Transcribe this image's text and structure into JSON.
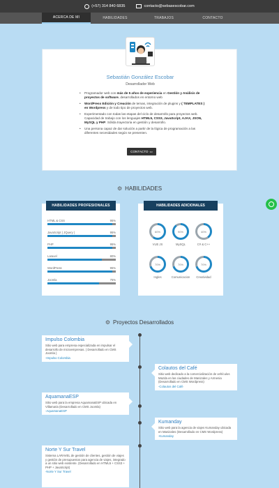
{
  "topbar": {
    "phone": "(+57) 314 840 6835",
    "email": "contacto@sebasescobar.com"
  },
  "nav": {
    "items": [
      {
        "label": "ACERCA DE MI"
      },
      {
        "label": "HABILIDADES"
      },
      {
        "label": "TRABAJOS"
      },
      {
        "label": "CONTACTO"
      }
    ]
  },
  "profile": {
    "name": "Sebastián González Escobar",
    "role": "Desarrollador Web",
    "bullets": [
      {
        "pre": "Programador web con ",
        "b1": "más de 5 años de experiencia",
        "mid": " en ",
        "b2": "Gestión y Análisis de proyectos de software",
        "post": ", desarrollados en entorno web"
      },
      {
        "pre": "",
        "b1": "WordPress Edición y Creación",
        "mid": " de temas, integración de plugins y ",
        "b2": "( TEMPLATES ) en Wordpress",
        "post": " y de todo tipo de proyectos web."
      },
      {
        "pre": "Experimentado con todas las etapas del ciclo de desarrollo para proyectos web. Capacidad de trabajo con los lenguajes ",
        "b1": "HTML5, CSS3, JavaScript, AJAX, JSON, MySQL y PHP",
        "mid": ". Sólida trayectoria en gestión y desarrollo.",
        "b2": "",
        "post": ""
      },
      {
        "pre": "Una persona capaz de dar solución a partir de la lógica de programación a las diferentes necesidades según se presenten.",
        "b1": "",
        "mid": "",
        "b2": "",
        "post": ""
      }
    ],
    "contact_label": "CONTACTO"
  },
  "skills_section": {
    "title": "HABILIDADES"
  },
  "professional": {
    "title": "HABILIDADES PROFESIONALES",
    "items": [
      {
        "name": "HTML & CSS",
        "pct": "95%",
        "value": 95
      },
      {
        "name": "JavaScript ( JQuery )",
        "pct": "95%",
        "value": 95
      },
      {
        "name": "PHP",
        "pct": "95%",
        "value": 95
      },
      {
        "name": "Laravel",
        "pct": "80%",
        "value": 80
      },
      {
        "name": "WordPress",
        "pct": "95%",
        "value": 95
      },
      {
        "name": "Joomla",
        "pct": "75%",
        "value": 75
      }
    ]
  },
  "additional": {
    "title": "HABILIDADES ADICIONALES",
    "items": [
      {
        "name": "VUE JS",
        "pct": "60%",
        "value": 60
      },
      {
        "name": "MySQL",
        "pct": "90%",
        "value": 90
      },
      {
        "name": "C# & C++",
        "pct": "40%",
        "value": 40
      },
      {
        "name": "Ingles",
        "pct": "70%",
        "value": 70
      },
      {
        "name": "Comunicacion",
        "pct": "70%",
        "value": 70
      },
      {
        "name": "Creatividad",
        "pct": "70%",
        "value": 70
      }
    ]
  },
  "projects_section": {
    "title": "Proyectos Desarrollados"
  },
  "projects": [
    {
      "title": "Impulso Colombia",
      "desc": "Sitio web para empresa especializada en impulsar el desarrollo de microempresas. ( Desarrollado en CMS Joomla )",
      "link": "-Impulso Colombia"
    },
    {
      "title": "Colautos del Café",
      "desc": "Sitio web dedicado a la comercialización de vehículos Mazda en las ciudades de Manizales y Armenia (Desarrollado en CMS Wordpress)",
      "link": "-Colautos del Café"
    },
    {
      "title": "AquamanaESP",
      "desc": "Sitio web para la empresa AquamanaESP ubicada en Villamaria (Desarrollado en CMS Joomla)",
      "link": "-AquamanaESP"
    },
    {
      "title": "Kumanday",
      "desc": "Sitio web para la agencia de viajes Kumanday ubicada en Manizales (Desarrollado en CMS Wordpress)",
      "link": "-Kumanday"
    },
    {
      "title": "Norte Y Sur Travel",
      "desc": "Sistema LARAVEL de gestión de clientes, gestión de viajes y gestión de presupuestos para agencia de viajes, integrado a un sitio web existente. (Desarrollado en HTML5 + CSS3 + PHP + JavaScript)",
      "link": "-Norte Y Sur Travel"
    }
  ],
  "colors": {
    "accent": "#1f87c4",
    "dark_header": "#17405f",
    "background": "#b9dcf3",
    "whatsapp": "#25c04a"
  }
}
